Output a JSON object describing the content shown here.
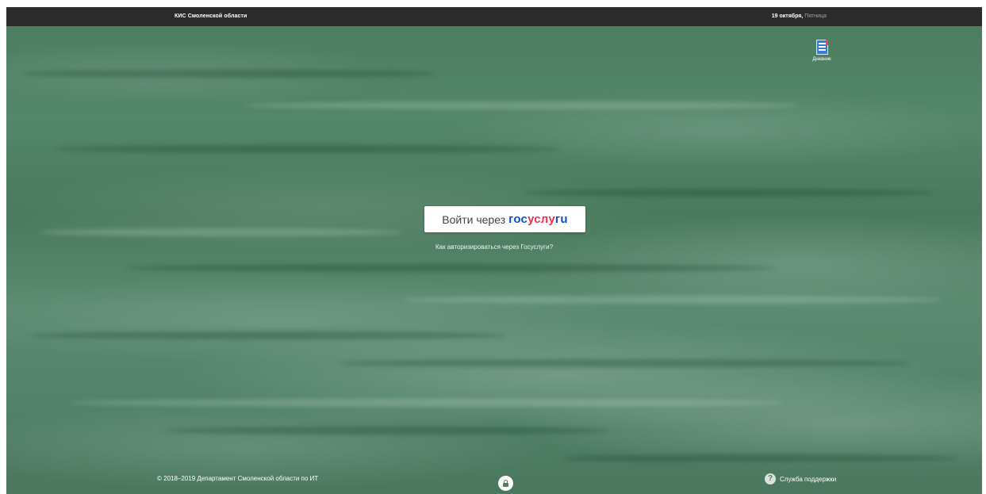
{
  "header": {
    "title": "КИС Смоленской области",
    "date": "19 октября,",
    "weekday": "Пятница"
  },
  "apps": [
    {
      "label": "Дневник",
      "icon": "diary-icon"
    }
  ],
  "login": {
    "prefix": "Войти через",
    "brand_part1": "гос",
    "brand_part2": "услу",
    "brand_part3": "гu",
    "help_link": "Как авторизироваться через Госуслуги?"
  },
  "footer": {
    "copyright": "© 2018–2019 Департамент Смоленской области по ИТ",
    "lock_icon": "lock-icon",
    "support_icon": "question-icon",
    "support_label": "Служба поддержки"
  },
  "colors": {
    "topbar": "#2b2b2b",
    "board": "#4f7d63",
    "brand_blue": "#0d4cd3",
    "brand_red": "#ee2f53"
  }
}
